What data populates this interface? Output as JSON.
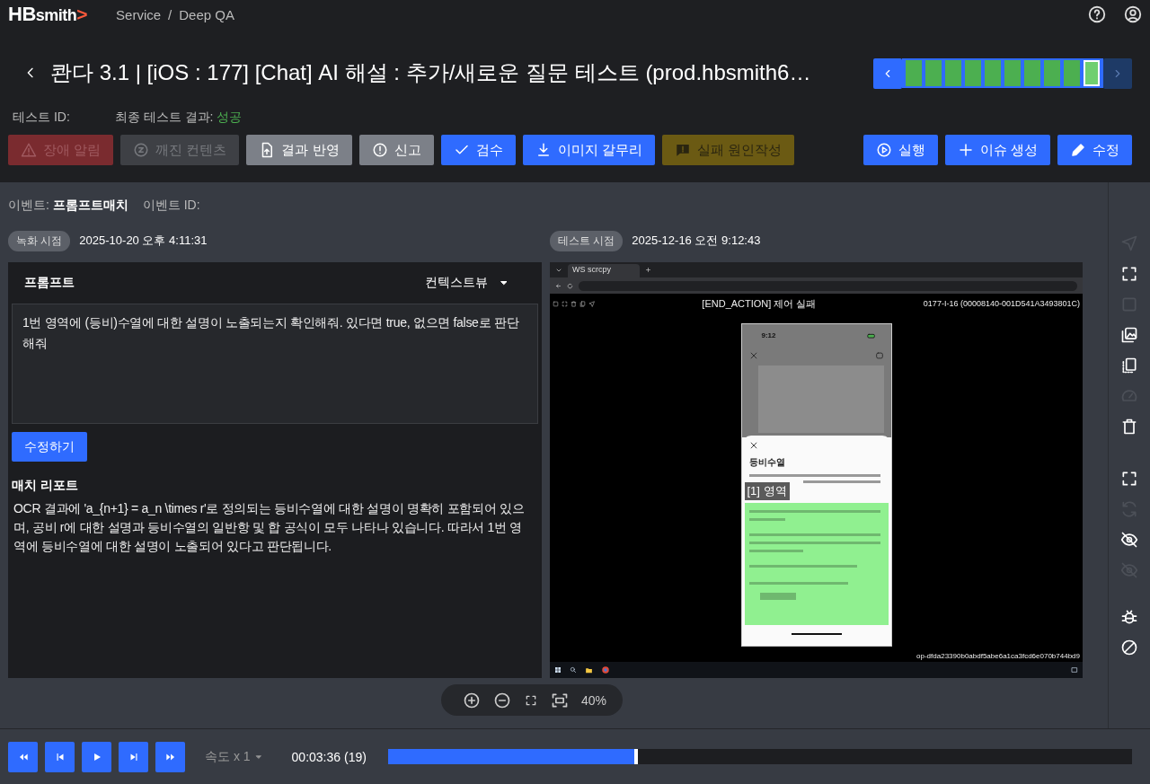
{
  "app": {
    "logo_bold": "HB",
    "logo_rest": "smith",
    "logo_mark": ">",
    "breadcrumb": [
      "Service",
      "Deep QA"
    ],
    "separator": "/"
  },
  "title": {
    "text": "콴다 3.1 | [iOS : 177] [Chat] AI 해설 : 추가/새로운 질문 테스트 (prod.hbsmith6…"
  },
  "timeline": {
    "steps": [
      {
        "selected": false
      },
      {
        "selected": false
      },
      {
        "selected": false
      },
      {
        "selected": false
      },
      {
        "selected": false
      },
      {
        "selected": false
      },
      {
        "selected": false
      },
      {
        "selected": false
      },
      {
        "selected": false
      },
      {
        "selected": true
      }
    ]
  },
  "test_info": {
    "id_label": "테스트 ID:",
    "result_label": "최종 테스트 결과:",
    "result": "성공"
  },
  "actions": [
    {
      "label": "장애 알림",
      "kind": "warning",
      "disabled": true
    },
    {
      "label": "깨진 컨텐츠",
      "kind": "broken",
      "disabled": true
    },
    {
      "label": "결과 반영",
      "kind": "upload",
      "disabled": false
    },
    {
      "label": "신고",
      "kind": "alert",
      "disabled": false
    },
    {
      "label": "검수",
      "kind": "check",
      "disabled": false
    },
    {
      "label": "이미지 갈무리",
      "kind": "download",
      "disabled": false
    },
    {
      "label": "실패 원인작성",
      "kind": "comment",
      "disabled": true
    }
  ],
  "right_actions": [
    {
      "label": "실행",
      "kind": "play",
      "disabled": false
    },
    {
      "label": "이슈 생성",
      "kind": "plus",
      "disabled": false
    },
    {
      "label": "수정",
      "kind": "pencil",
      "disabled": false
    }
  ],
  "event": {
    "label": "이벤트:",
    "name": "프롬프트매치",
    "id_label": "이벤트 ID:"
  },
  "recorded": {
    "badge": "녹화 시점",
    "time": "2025-10-20 오후 4:11:31"
  },
  "tested": {
    "badge": "테스트 시점",
    "time": "2025-12-16 오전 9:12:43"
  },
  "prompt": {
    "title": "프롬프트",
    "view": "컨텍스트뷰",
    "text": "1번 영역에 (등비)수열에 대한 설명이 노출되는지 확인해줘. 있다면 true, 없으면 false로 판단해줘",
    "edit_button": "수정하기"
  },
  "report": {
    "title": "매치 리포트",
    "text": "OCR 결과에 'a_{n+1} = a_n \\times r'로 정의되는 등비수열에 대한 설명이 명확히 포함되어 있으며, 공비 r에 대한 설명과 등비수열의 일반항 및 합 공식이 모두 나타나 있습니다. 따라서 1번 영역에 등비수열에 대한 설명이 노출되어 있다고 판단됩니다."
  },
  "capture": {
    "tab_title": "WS scrcpy",
    "action_title": "[END_ACTION] 제어 실패",
    "device": "0177-I-16 (00008140-001D541A3493801C)",
    "op_id": "op-dfda23390b0abdf5abe6a1ca3fcd6e070b744bd9",
    "phone": {
      "time": "9:12",
      "sheet_title": "등비수열",
      "region_label": "[1] 영역"
    }
  },
  "zoom": {
    "level_text": "40%"
  },
  "sidebar_groups": [
    {
      "items": [
        {
          "kind": "send",
          "disabled": true
        },
        {
          "kind": "corners",
          "disabled": false
        },
        {
          "kind": "square",
          "disabled": true
        },
        {
          "kind": "images",
          "disabled": false
        },
        {
          "kind": "copy",
          "disabled": false
        },
        {
          "kind": "gauge",
          "disabled": true
        },
        {
          "kind": "trash",
          "disabled": false
        }
      ]
    },
    {
      "items": [
        {
          "kind": "corners",
          "disabled": false
        },
        {
          "kind": "refresh",
          "disabled": true
        },
        {
          "kind": "eyeoff",
          "disabled": false
        },
        {
          "kind": "eyeoff",
          "disabled": true
        }
      ]
    },
    {
      "items": [
        {
          "kind": "bug",
          "disabled": false
        },
        {
          "kind": "block",
          "disabled": false
        }
      ]
    }
  ],
  "player": {
    "controls": [
      {
        "kind": "rewind"
      },
      {
        "kind": "prev"
      },
      {
        "kind": "play"
      },
      {
        "kind": "next"
      },
      {
        "kind": "forward"
      }
    ],
    "speed": "속도 x 1",
    "time": "00:03:36 (19)",
    "level": 0.333
  }
}
